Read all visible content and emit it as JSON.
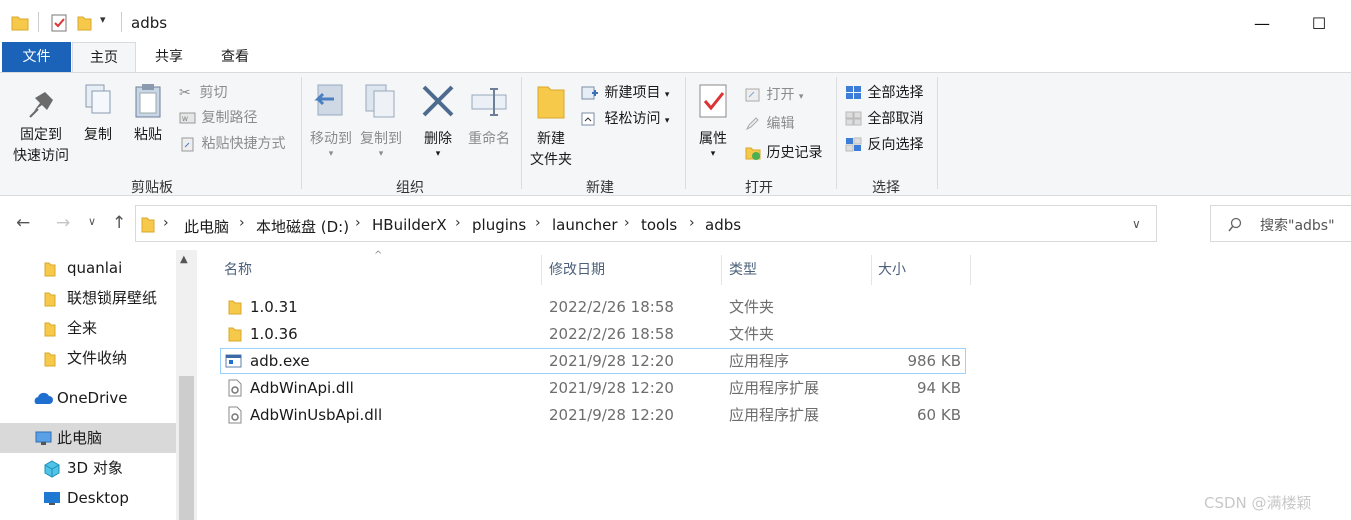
{
  "window": {
    "title": "adbs"
  },
  "tabs": {
    "file": "文件",
    "home": "主页",
    "share": "共享",
    "view": "查看"
  },
  "ribbon": {
    "clipboard": {
      "label": "剪贴板",
      "pin_line1": "固定到",
      "pin_line2": "快速访问",
      "copy": "复制",
      "paste": "粘贴",
      "cut": "剪切",
      "copy_path": "复制路径",
      "paste_shortcut": "粘贴快捷方式"
    },
    "organize": {
      "label": "组织",
      "move_to": "移动到",
      "copy_to": "复制到",
      "delete": "删除",
      "rename": "重命名"
    },
    "new": {
      "label": "新建",
      "new_folder_line1": "新建",
      "new_folder_line2": "文件夹",
      "new_item": "新建项目",
      "easy_access": "轻松访问"
    },
    "open": {
      "label": "打开",
      "properties": "属性",
      "open": "打开",
      "edit": "编辑",
      "history": "历史记录"
    },
    "select": {
      "label": "选择",
      "select_all": "全部选择",
      "select_none": "全部取消",
      "invert": "反向选择"
    }
  },
  "address": {
    "crumbs": [
      "此电脑",
      "本地磁盘 (D:)",
      "HBuilderX",
      "plugins",
      "launcher",
      "tools",
      "adbs"
    ],
    "search_placeholder": "搜索\"adbs\""
  },
  "navpane": {
    "items": [
      {
        "label": "quanlai",
        "icon": "folder-icon"
      },
      {
        "label": "联想锁屏壁纸",
        "icon": "folder-icon"
      },
      {
        "label": "全来",
        "icon": "folder-icon"
      },
      {
        "label": "文件收纳",
        "icon": "folder-icon"
      },
      {
        "label": "OneDrive",
        "icon": "cloud-icon"
      },
      {
        "label": "此电脑",
        "icon": "computer-icon"
      },
      {
        "label": "3D 对象",
        "icon": "cube-icon"
      },
      {
        "label": "Desktop",
        "icon": "desktop-icon"
      }
    ]
  },
  "columns": {
    "name": "名称",
    "modified": "修改日期",
    "type": "类型",
    "size": "大小"
  },
  "files": [
    {
      "name": "1.0.31",
      "modified": "2022/2/26 18:58",
      "type": "文件夹",
      "size": "",
      "icon": "folder-icon"
    },
    {
      "name": "1.0.36",
      "modified": "2022/2/26 18:58",
      "type": "文件夹",
      "size": "",
      "icon": "folder-icon"
    },
    {
      "name": "adb.exe",
      "modified": "2021/9/28 12:20",
      "type": "应用程序",
      "size": "986 KB",
      "icon": "exe-icon"
    },
    {
      "name": "AdbWinApi.dll",
      "modified": "2021/9/28 12:20",
      "type": "应用程序扩展",
      "size": "94 KB",
      "icon": "dll-icon"
    },
    {
      "name": "AdbWinUsbApi.dll",
      "modified": "2021/9/28 12:20",
      "type": "应用程序扩展",
      "size": "60 KB",
      "icon": "dll-icon"
    }
  ],
  "watermark": "CSDN @满楼颖",
  "colors": {
    "file_tab": "#1a63b8",
    "folder": "#f7c94b",
    "selection": "#99d1ff"
  }
}
